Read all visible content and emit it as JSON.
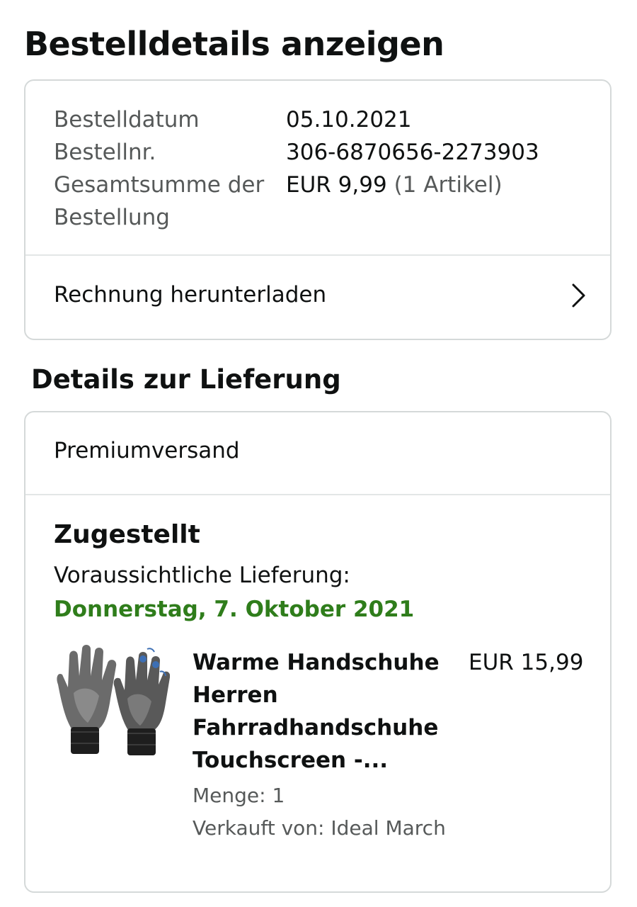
{
  "page": {
    "title": "Bestelldetails anzeigen"
  },
  "order_summary": {
    "rows": [
      {
        "label": "Bestelldatum",
        "value": "05.10.2021"
      },
      {
        "label": "Bestellnr.",
        "value": "306-6870656-2273903"
      },
      {
        "label": "Gesamtsumme der Bestellung",
        "value": "EUR 9,99",
        "value_note": "(1 Artikel)"
      }
    ],
    "invoice_link": "Rechnung herunterladen",
    "invoice_icon": "chevron-right-icon"
  },
  "delivery": {
    "section_title": "Details zur Lieferung",
    "shipping_type": "Premiumversand",
    "status": "Zugestellt",
    "eta_label": "Voraussichtliche Lieferung:",
    "eta_date": "Donnerstag, 7. Oktober 2021",
    "eta_color": "#2f7d1b",
    "item": {
      "image_icon": "gloves-product-image",
      "title": "Warme Handschuhe Herren Fahrradhandschuhe Touchscreen -...",
      "price": "EUR 15,99",
      "quantity": "Menge: 1",
      "seller": "Verkauft von: Ideal March"
    }
  },
  "colors": {
    "text_primary": "#0f1111",
    "text_secondary": "#565959",
    "border": "#d5d9d9",
    "delivery_green": "#2f7d1b"
  }
}
